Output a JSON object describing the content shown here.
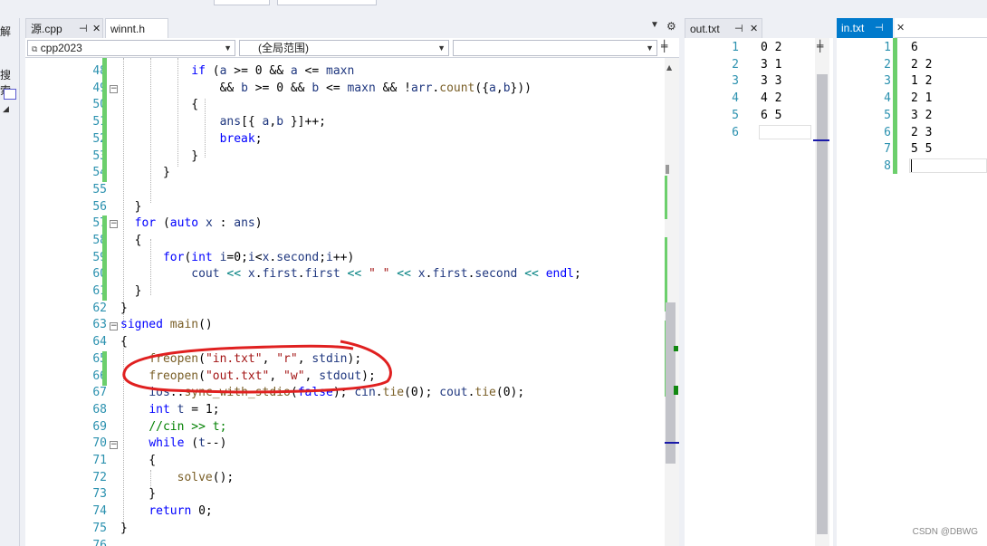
{
  "tabs": {
    "source_tab": "源.cpp",
    "header_tab": "winnt.h",
    "out_tab": "out.txt",
    "in_tab": "in.txt"
  },
  "left_strip": {
    "label_top": "解",
    "label_search": "搜索"
  },
  "navbar": {
    "project": "cpp2023",
    "scope": "(全局范围)",
    "member": ""
  },
  "editor": {
    "line_numbers": [
      "48",
      "49",
      "50",
      "51",
      "52",
      "53",
      "54",
      "55",
      "56",
      "57",
      "58",
      "59",
      "60",
      "61",
      "62",
      "63",
      "64",
      "65",
      "66",
      "67",
      "68",
      "69",
      "70",
      "71",
      "72",
      "73",
      "74",
      "75",
      "76"
    ]
  },
  "out_panel": {
    "line_numbers": [
      "1",
      "2",
      "3",
      "4",
      "5",
      "6"
    ],
    "lines": [
      "0 2",
      "3 1",
      "3 3",
      "4 2",
      "6 5",
      ""
    ]
  },
  "in_panel": {
    "line_numbers": [
      "1",
      "2",
      "3",
      "4",
      "5",
      "6",
      "7",
      "8"
    ],
    "lines": [
      "6",
      "2 2",
      "1 2",
      "2 1",
      "3 2",
      "2 3",
      "5 5",
      ""
    ]
  },
  "watermark": "CSDN @DBWG",
  "colors": {
    "active_tab": "#007acc",
    "change_marker": "#6ccf6c",
    "annotation": "#e02020",
    "line_number": "#2b91af",
    "keyword": "#0000ff"
  }
}
